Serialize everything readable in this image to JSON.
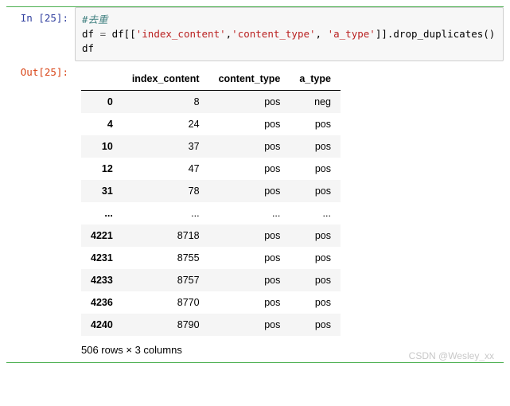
{
  "input": {
    "prompt": "In [25]:",
    "code": {
      "comment": "#去重",
      "line2_pre": "df ",
      "line2_eq": "=",
      "line2_mid": " df[[",
      "str1": "'index_content'",
      "sep1": ",",
      "str2": "'content_type'",
      "sep2": ", ",
      "str3": "'a_type'",
      "line2_post": "]].drop_duplicates()",
      "line3": "df"
    }
  },
  "output": {
    "prompt": "Out[25]:",
    "columns": [
      "",
      "index_content",
      "content_type",
      "a_type"
    ],
    "rows": [
      {
        "idx": "0",
        "c1": "8",
        "c2": "pos",
        "c3": "neg"
      },
      {
        "idx": "4",
        "c1": "24",
        "c2": "pos",
        "c3": "pos"
      },
      {
        "idx": "10",
        "c1": "37",
        "c2": "pos",
        "c3": "pos"
      },
      {
        "idx": "12",
        "c1": "47",
        "c2": "pos",
        "c3": "pos"
      },
      {
        "idx": "31",
        "c1": "78",
        "c2": "pos",
        "c3": "pos"
      },
      {
        "idx": "...",
        "c1": "...",
        "c2": "...",
        "c3": "..."
      },
      {
        "idx": "4221",
        "c1": "8718",
        "c2": "pos",
        "c3": "pos"
      },
      {
        "idx": "4231",
        "c1": "8755",
        "c2": "pos",
        "c3": "pos"
      },
      {
        "idx": "4233",
        "c1": "8757",
        "c2": "pos",
        "c3": "pos"
      },
      {
        "idx": "4236",
        "c1": "8770",
        "c2": "pos",
        "c3": "pos"
      },
      {
        "idx": "4240",
        "c1": "8790",
        "c2": "pos",
        "c3": "pos"
      }
    ],
    "shape_info": "506 rows × 3 columns"
  },
  "watermark": "CSDN @Wesley_xx"
}
